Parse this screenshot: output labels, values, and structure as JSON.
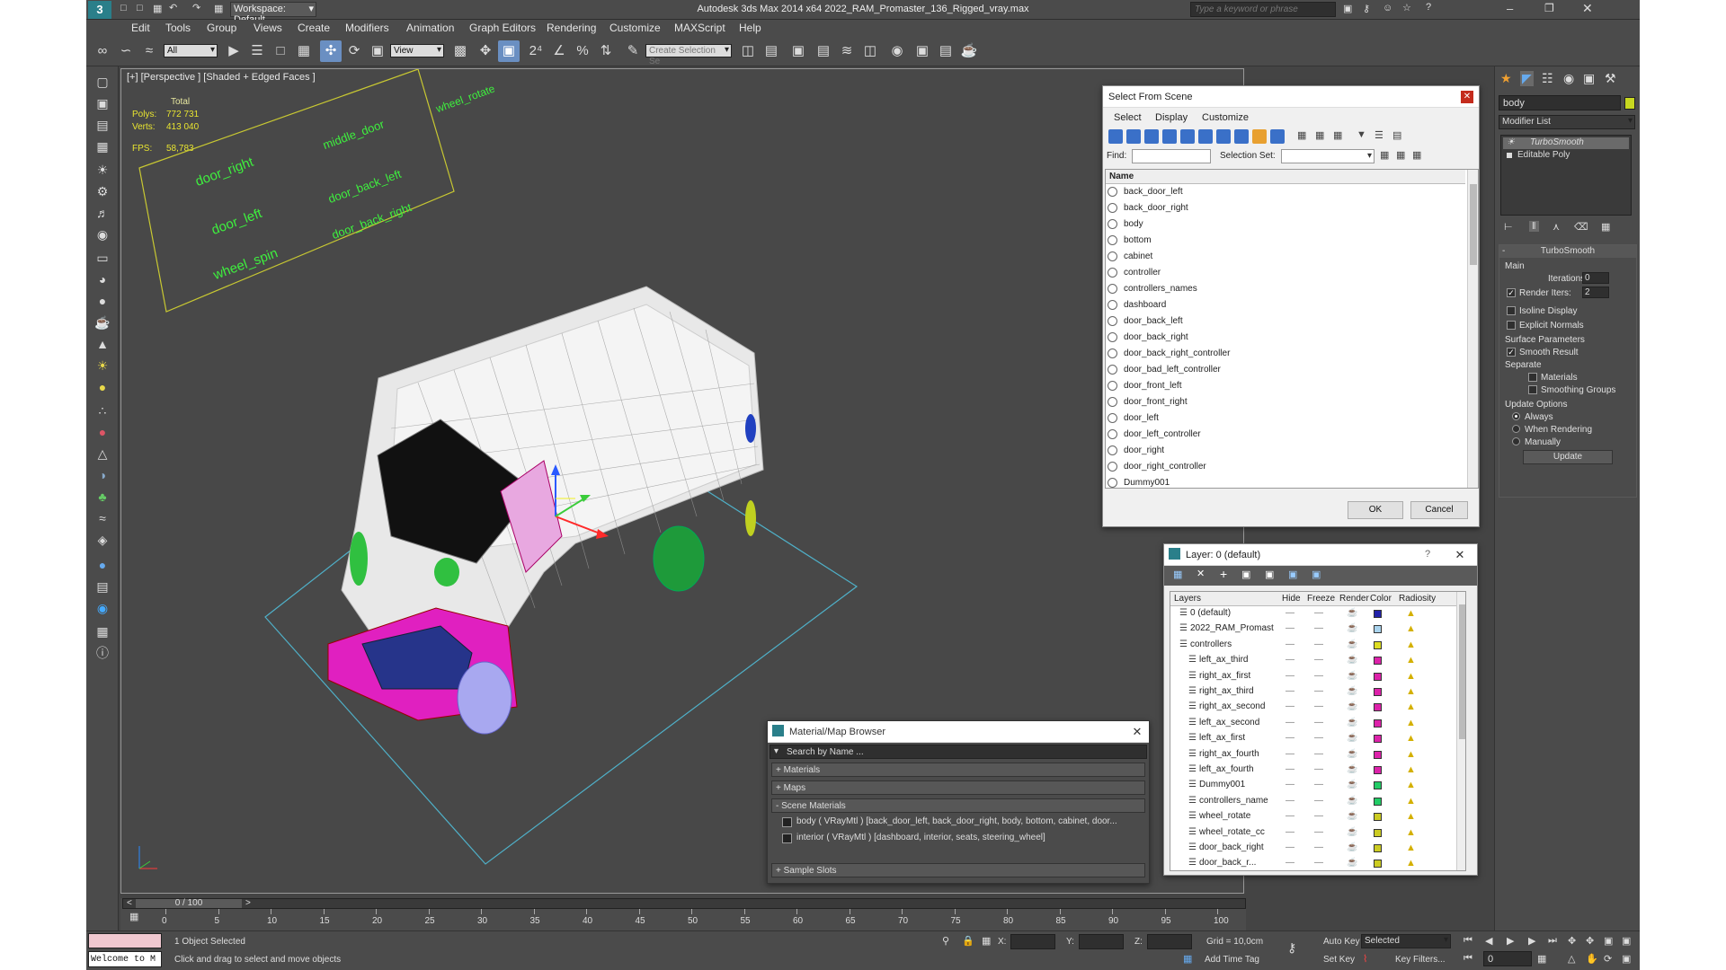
{
  "window": {
    "title": "Autodesk 3ds Max  2014 x64     2022_RAM_Promaster_136_Rigged_vray.max",
    "workspace": "Workspace: Default",
    "search_placeholder": "Type a keyword or phrase"
  },
  "menu": [
    "Edit",
    "Tools",
    "Group",
    "Views",
    "Create",
    "Modifiers",
    "Animation",
    "Graph Editors",
    "Rendering",
    "Customize",
    "MAXScript",
    "Help"
  ],
  "toolbar": {
    "filter": "All",
    "refcoord": "View",
    "selection_set": "Create Selection Se"
  },
  "viewport": {
    "label": "[+] [Perspective ] [Shaded + Edged Faces ]",
    "stats": {
      "total": "Total",
      "polys_label": "Polys:",
      "polys": "772 731",
      "verts_label": "Verts:",
      "verts": "413 040",
      "fps_label": "FPS:",
      "fps": "58,783"
    },
    "controllers": [
      "door_right",
      "middle_door",
      "wheel_rotate",
      "door_left",
      "door_back_left",
      "wheel_spin",
      "door_back_right"
    ]
  },
  "select_dialog": {
    "title": "Select From Scene",
    "menu": [
      "Select",
      "Display",
      "Customize"
    ],
    "find_label": "Find:",
    "selset_label": "Selection Set:",
    "column": "Name",
    "items": [
      "back_door_left",
      "back_door_right",
      "body",
      "bottom",
      "cabinet",
      "controller",
      "controllers_names",
      "dashboard",
      "door_back_left",
      "door_back_right",
      "door_back_right_controller",
      "door_bad_left_controller",
      "door_front_left",
      "door_front_right",
      "door_left",
      "door_left_controller",
      "door_right",
      "door_right_controller",
      "Dummy001"
    ],
    "ok": "OK",
    "cancel": "Cancel"
  },
  "layer_dialog": {
    "title": "Layer: 0 (default)",
    "help": "?",
    "columns": [
      "Layers",
      "Hide",
      "Freeze",
      "Render",
      "Color",
      "Radiosity"
    ],
    "rows": [
      {
        "name": "0 (default)",
        "color": "#2222aa",
        "indent": 0
      },
      {
        "name": "2022_RAM_Promast",
        "color": "#aad4ee",
        "indent": 0
      },
      {
        "name": "controllers",
        "color": "#dddd22",
        "indent": 0
      },
      {
        "name": "left_ax_third",
        "color": "#dd22aa",
        "indent": 1
      },
      {
        "name": "right_ax_first",
        "color": "#dd22aa",
        "indent": 1
      },
      {
        "name": "right_ax_third",
        "color": "#dd22aa",
        "indent": 1
      },
      {
        "name": "right_ax_second",
        "color": "#dd22aa",
        "indent": 1
      },
      {
        "name": "left_ax_second",
        "color": "#dd22aa",
        "indent": 1
      },
      {
        "name": "left_ax_first",
        "color": "#dd22aa",
        "indent": 1
      },
      {
        "name": "right_ax_fourth",
        "color": "#dd22aa",
        "indent": 1
      },
      {
        "name": "left_ax_fourth",
        "color": "#dd22aa",
        "indent": 1
      },
      {
        "name": "Dummy001",
        "color": "#22cc66",
        "indent": 1
      },
      {
        "name": "controllers_name",
        "color": "#22cc66",
        "indent": 1
      },
      {
        "name": "wheel_rotate",
        "color": "#cccc22",
        "indent": 1
      },
      {
        "name": "wheel_rotate_cc",
        "color": "#cccc22",
        "indent": 1
      },
      {
        "name": "door_back_right",
        "color": "#cccc22",
        "indent": 1
      },
      {
        "name": "door_back_r...",
        "color": "#cccc22",
        "indent": 1
      }
    ]
  },
  "material_browser": {
    "title": "Material/Map Browser",
    "search": "Search by Name ...",
    "groups": [
      "+ Materials",
      "+ Maps",
      "- Scene Materials"
    ],
    "materials": [
      "body ( VRayMtl ) [back_door_left, back_door_right, body, bottom, cabinet, door...",
      "interior ( VRayMtl ) [dashboard, interior, seats, steering_wheel]"
    ],
    "sample_slots": "+ Sample Slots"
  },
  "command_panel": {
    "object_name": "body",
    "modifier_list": "Modifier List",
    "stack": [
      "TurboSmooth",
      "Editable Poly"
    ],
    "turbosmooth": {
      "title": "TurboSmooth",
      "main": "Main",
      "iterations_label": "Iterations:",
      "iterations": "0",
      "render_iters_label": "Render Iters:",
      "render_iters": "2",
      "isoline": "Isoline Display",
      "explicit": "Explicit Normals",
      "surface": "Surface Parameters",
      "smooth_result": "Smooth Result",
      "separate": "Separate",
      "materials": "Materials",
      "smoothing_groups": "Smoothing Groups",
      "update_options": "Update Options",
      "always": "Always",
      "when_rendering": "When Rendering",
      "manually": "Manually",
      "update": "Update"
    }
  },
  "timeline": {
    "frame": "0 / 100",
    "ticks": [
      "0",
      "5",
      "10",
      "15",
      "20",
      "25",
      "30",
      "35",
      "40",
      "45",
      "50",
      "55",
      "60",
      "65",
      "70",
      "75",
      "80",
      "85",
      "90",
      "95",
      "100"
    ]
  },
  "status": {
    "selected": "1 Object Selected",
    "hint": "Click and drag to select and move objects",
    "welcome": "Welcome to M",
    "x_label": "X:",
    "y_label": "Y:",
    "z_label": "Z:",
    "grid": "Grid = 10,0cm",
    "add_time_tag": "Add Time Tag",
    "auto_key": "Auto Key",
    "set_key": "Set Key",
    "key_mode": "Selected",
    "key_filters": "Key Filters...",
    "frame_field": "0"
  }
}
